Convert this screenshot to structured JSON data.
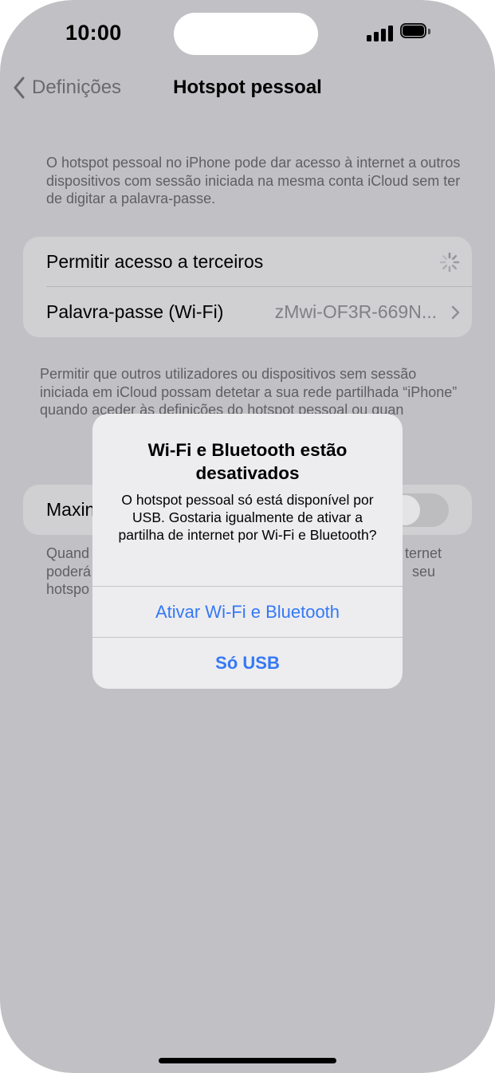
{
  "status_bar": {
    "time": "10:00"
  },
  "nav": {
    "back_label": "Definições",
    "title": "Hotspot pessoal"
  },
  "intro_text": "O hotspot pessoal no iPhone pode dar acesso à internet a outros dispositivos com sessão iniciada na mesma conta iCloud sem ter de digitar a palavra-passe.",
  "settings": {
    "allow_others_label": "Permitir acesso a terceiros",
    "password_label": "Palavra-passe (Wi-Fi)",
    "password_value": "zMwi-OF3R-669N..."
  },
  "allow_footer": "Permitir que outros utilizadores ou dispositivos sem sessão iniciada em iCloud possam detetar a sua rede partilhada “iPhone” quando aceder às definições do hotspot pessoal ou quan",
  "maximize": {
    "label": "Maxin",
    "toggle_on": false
  },
  "maximize_footer": {
    "left_lines": [
      "Quand",
      "poderá",
      "hotspo"
    ],
    "right_lines": [
      "ternet",
      "seu"
    ]
  },
  "alert": {
    "title": "Wi-Fi e Bluetooth estão desativados",
    "message": "O hotspot pessoal só está disponível por USB. Gostaria igualmente de ativar a partilha de internet por Wi-Fi e Bluetooth?",
    "primary_button": "Ativar Wi-Fi e Bluetooth",
    "secondary_button": "Só USB"
  },
  "colors": {
    "dimmed_background": "#c1c1c5",
    "alert_background": "#ededef",
    "accent": "#3478f6"
  },
  "icons": [
    "signal-icon",
    "battery-icon",
    "chevron-left-icon",
    "chevron-right-icon",
    "spinner-icon"
  ]
}
